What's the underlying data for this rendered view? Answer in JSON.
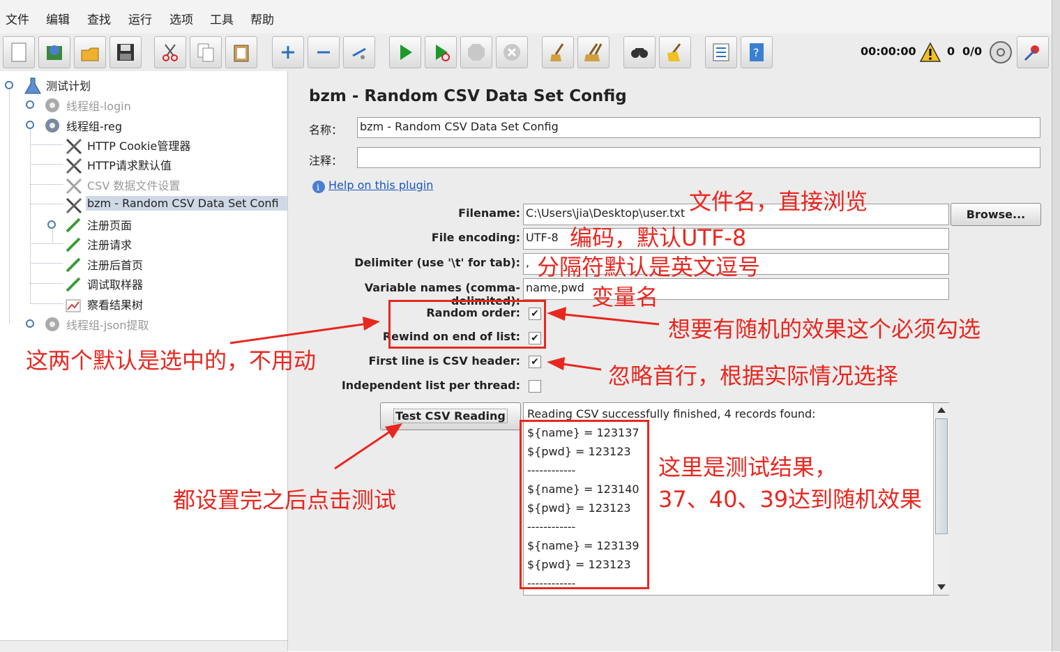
{
  "menu": [
    "文件",
    "编辑",
    "查找",
    "运行",
    "选项",
    "工具",
    "帮助"
  ],
  "toolbar": {
    "buttons": [
      "new-icon",
      "templates-icon",
      "open-icon",
      "save-icon",
      "cut-icon",
      "copy-icon",
      "paste-icon",
      "expand-icon",
      "collapse-icon",
      "toggle-icon",
      "start-icon",
      "start-no-pause-icon",
      "stop-icon",
      "shutdown-icon",
      "clear-icon",
      "clear-all-icon",
      "search-icon",
      "reset-search-icon",
      "function-helper-icon",
      "help-icon"
    ],
    "timer": "00:00:00",
    "warnings": "0",
    "threads": "0/0"
  },
  "tree": {
    "items": [
      {
        "label": "测试计划",
        "disabled": false
      },
      {
        "label": "线程组-login",
        "disabled": true
      },
      {
        "label": "线程组-reg",
        "disabled": false
      },
      {
        "label": "HTTP Cookie管理器",
        "disabled": false
      },
      {
        "label": "HTTP请求默认值",
        "disabled": false
      },
      {
        "label": "CSV 数据文件设置",
        "disabled": true
      },
      {
        "label": "bzm - Random CSV Data Set Confi",
        "disabled": false,
        "selected": true
      },
      {
        "label": "注册页面",
        "disabled": false
      },
      {
        "label": "注册请求",
        "disabled": false
      },
      {
        "label": "注册后首页",
        "disabled": false
      },
      {
        "label": "调试取样器",
        "disabled": false
      },
      {
        "label": "察看结果树",
        "disabled": false
      },
      {
        "label": "线程组-json提取",
        "disabled": true
      }
    ]
  },
  "panel": {
    "title": "bzm - Random CSV Data Set Config",
    "name_label": "名称：",
    "name_value": "bzm - Random CSV Data Set Config",
    "comment_label": "注释：",
    "comment_value": "",
    "help_link": "Help on this plugin",
    "filename_label": "Filename:",
    "filename_value": "C:\\Users\\jia\\Desktop\\user.txt",
    "browse": "Browse...",
    "encoding_label": "File encoding:",
    "encoding_value": "UTF-8",
    "delimiter_label": "Delimiter (use '\\t' for tab):",
    "delimiter_value": ",",
    "varnames_label": "Variable names (comma-delimited):",
    "varnames_value": "name,pwd",
    "random_label": "Random order:",
    "random_checked": true,
    "rewind_label": "Rewind on end of list:",
    "rewind_checked": true,
    "header_label": "First line is CSV header:",
    "header_checked": true,
    "independent_label": "Independent list per thread:",
    "independent_checked": false,
    "test_button": "Test CSV Reading",
    "results": [
      "Reading CSV successfully finished, 4 records found:",
      "${name} = 123137",
      "${pwd} = 123123",
      "------------",
      "${name} = 123140",
      "${pwd} = 123123",
      "------------",
      "${name} = 123139",
      "${pwd} = 123123",
      "------------"
    ]
  },
  "annotations": {
    "filename": "文件名，直接浏览",
    "encoding": "编码，默认UTF-8",
    "delimiter": "分隔符默认是英文逗号",
    "varnames": "变量名",
    "random": "想要有随机的效果这个必须勾选",
    "defaults": "这两个默认是选中的，不用动",
    "header": "忽略首行，根据实际情况选择",
    "test": "都设置完之后点击测试",
    "result1": "这里是测试结果，",
    "result2": "37、40、39达到随机效果"
  },
  "colors": {
    "annotation": "#e8271f",
    "link": "#1a55c0",
    "selection": "#cfd9e6"
  }
}
